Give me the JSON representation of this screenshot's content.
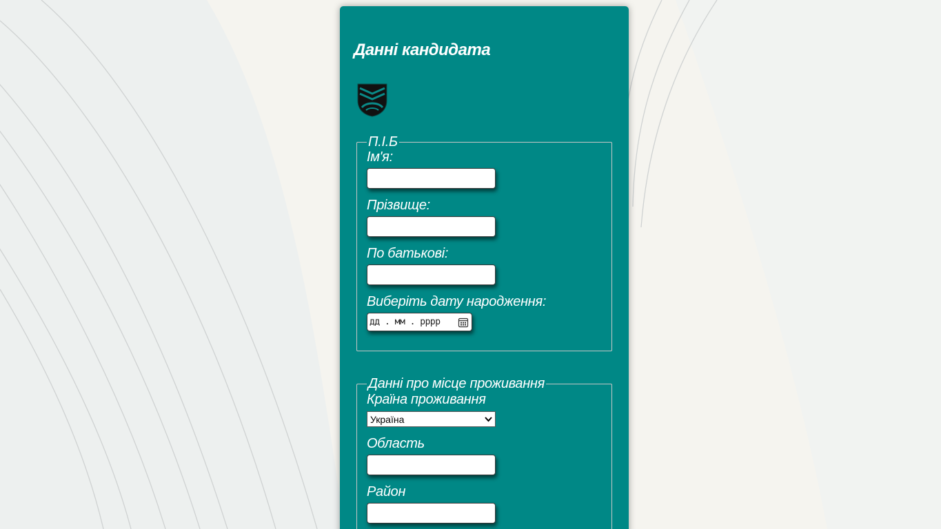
{
  "form": {
    "title": "Данні кандидата",
    "logo_icon": "shield-crest-icon",
    "name_section": {
      "legend": "П.І.Б",
      "first_name_label": "Ім'я:",
      "first_name_value": "",
      "last_name_label": "Прізвище:",
      "last_name_value": "",
      "patronymic_label": "По батькові:",
      "patronymic_value": "",
      "birth_date_label": "Виберіть дату народження:",
      "birth_date_placeholder": "дд . мм . рррр"
    },
    "address_section": {
      "legend": "Данні про місце проживання",
      "country_label": "Країна проживання",
      "country_value": "Україна",
      "region_label": "Область",
      "region_value": "",
      "district_label": "Район",
      "district_value": ""
    }
  },
  "colors": {
    "card": "#008886",
    "background": "#f5f4ef",
    "text": "#ffffff"
  }
}
